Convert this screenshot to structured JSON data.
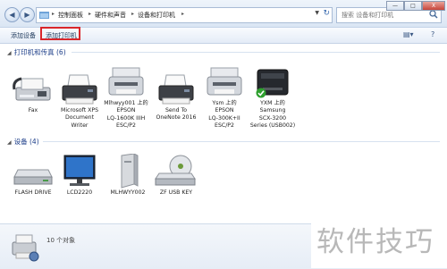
{
  "address_bar": {
    "crumbs": [
      "控制面板",
      "硬件和声音",
      "设备和打印机"
    ],
    "search_placeholder": "搜索 设备和打印机"
  },
  "window_controls": {
    "minimize": "—",
    "maximize": "□",
    "close": "X"
  },
  "toolbar": {
    "add_device": "添加设备",
    "add_printer": "添加打印机",
    "highlight_color": "#d9262b"
  },
  "groups": {
    "printers": {
      "header": "打印机和传真 (6)",
      "items": [
        {
          "label": "Fax",
          "icon": "fax-icon"
        },
        {
          "label": "Microsoft XPS\nDocument\nWriter",
          "icon": "printer-icon"
        },
        {
          "label": "Mlhwyy001 上的\nEPSON\nLQ-1600K IIIH\nESC/P2",
          "icon": "printer-icon"
        },
        {
          "label": "Send To\nOneNote 2016",
          "icon": "printer-icon"
        },
        {
          "label": "Ysm 上的\nEPSON\nLQ-300K+II\nESC/P2",
          "icon": "printer-icon"
        },
        {
          "label": "YXM 上的\nSamsung\nSCX-3200\nSeries (USB002)",
          "icon": "laser-printer-icon",
          "default": true
        }
      ]
    },
    "devices": {
      "header": "设备 (4)",
      "items": [
        {
          "label": "FLASH DRIVE",
          "icon": "drive-icon"
        },
        {
          "label": "LCD2220",
          "icon": "monitor-icon"
        },
        {
          "label": "MLHWYY002",
          "icon": "computer-tower-icon"
        },
        {
          "label": "ZF USB KEY",
          "icon": "optical-drive-icon"
        }
      ]
    }
  },
  "details": {
    "count_text": "10 个对象"
  },
  "watermark": "软件技巧",
  "colors": {
    "accent": "#1e3f8a",
    "check": "#2fa02f"
  }
}
